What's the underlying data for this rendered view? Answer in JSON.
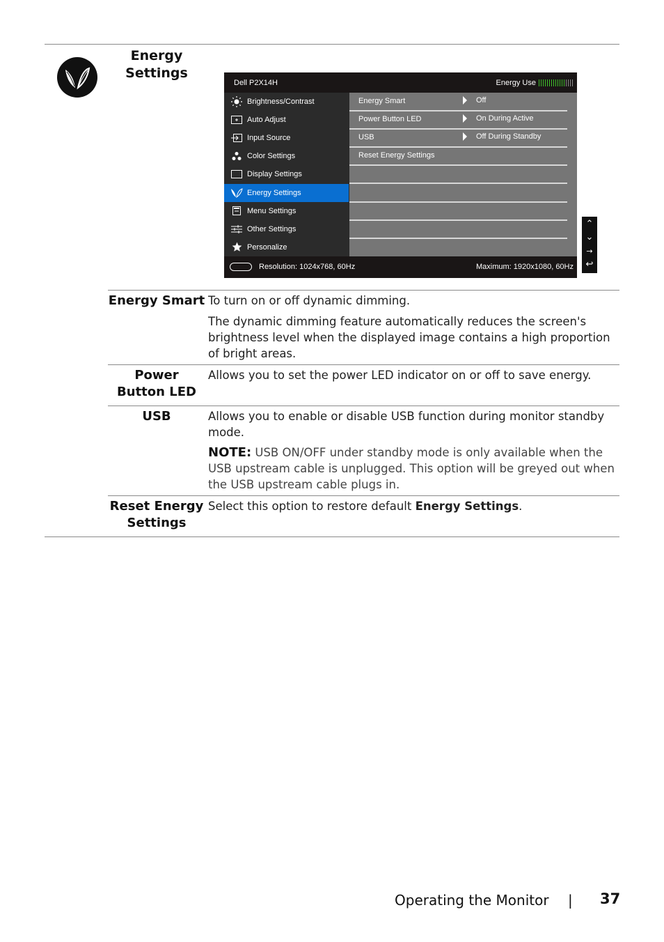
{
  "section": {
    "title_line1": "Energy",
    "title_line2": "Settings",
    "icon": "energy-leaf-icon"
  },
  "osd": {
    "model": "Dell P2X14H",
    "energy_use_label": "Energy Use",
    "energy_use_level": {
      "filled": 13,
      "total": 17
    },
    "colors": {
      "accent": "#0a6fd1",
      "energy_bar_on": "#3fbf2a",
      "energy_bar_off": "#8a8a8a"
    },
    "menu_items": [
      {
        "label": "Brightness/Contrast",
        "icon": "brightness-icon",
        "selected": false
      },
      {
        "label": "Auto Adjust",
        "icon": "auto-adjust-icon",
        "selected": false
      },
      {
        "label": "Input Source",
        "icon": "input-source-icon",
        "selected": false
      },
      {
        "label": "Color Settings",
        "icon": "color-settings-icon",
        "selected": false
      },
      {
        "label": "Display Settings",
        "icon": "display-settings-icon",
        "selected": false
      },
      {
        "label": "Energy Settings",
        "icon": "energy-leaf-icon",
        "selected": true
      },
      {
        "label": "Menu Settings",
        "icon": "menu-settings-icon",
        "selected": false
      },
      {
        "label": "Other Settings",
        "icon": "other-settings-icon",
        "selected": false
      },
      {
        "label": "Personalize",
        "icon": "star-icon",
        "selected": false
      }
    ],
    "submenu": [
      {
        "label": "Energy Smart",
        "value": "Off"
      },
      {
        "label": "Power Button LED",
        "value": "On During Active"
      },
      {
        "label": "USB",
        "value": "Off During Standby"
      },
      {
        "label": "Reset Energy Settings",
        "value": ""
      }
    ],
    "footer": {
      "resolution": "Resolution: 1024x768, 60Hz",
      "maximum": "Maximum: 1920x1080, 60Hz"
    },
    "nav_buttons": [
      "up-icon",
      "down-icon",
      "enter-icon",
      "back-icon"
    ]
  },
  "nav_glyphs": {
    "up": "⌃",
    "down": "⌄",
    "enter": "→",
    "back": "↩"
  },
  "table": {
    "rows": [
      {
        "term": "Energy Smart",
        "desc1": "To turn on or off dynamic dimming.",
        "desc2": "The dynamic dimming feature automatically reduces the screen's brightness level when the displayed image contains a high proportion of bright areas."
      },
      {
        "term_line1": "Power",
        "term_line2": "Button LED",
        "desc1": "Allows you to set the power LED indicator on or off to save energy."
      },
      {
        "term": "USB",
        "desc1": "Allows you to enable or disable USB function during monitor standby mode.",
        "note_label": "NOTE:",
        "note_text": " USB ON/OFF under standby mode is only available when the USB upstream cable is unplugged. This option will be greyed out when the USB upstream cable plugs in."
      },
      {
        "term_line1": "Reset Energy",
        "term_line2": "Settings",
        "desc_prefix": "Select this option to restore default ",
        "desc_bold": "Energy Settings",
        "desc_suffix": "."
      }
    ]
  },
  "footer": {
    "chapter": "Operating the Monitor",
    "separator": "|",
    "page": "37"
  }
}
